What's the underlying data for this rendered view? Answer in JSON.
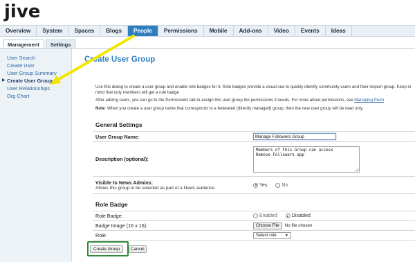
{
  "brand": {
    "logo_text": "jive"
  },
  "top_nav": {
    "tabs": [
      {
        "label": "Overview"
      },
      {
        "label": "System"
      },
      {
        "label": "Spaces"
      },
      {
        "label": "Blogs"
      },
      {
        "label": "People",
        "active": true
      },
      {
        "label": "Permissions"
      },
      {
        "label": "Mobile"
      },
      {
        "label": "Add-ons"
      },
      {
        "label": "Video"
      },
      {
        "label": "Events"
      },
      {
        "label": "Ideas"
      }
    ]
  },
  "sub_tabs": [
    {
      "label": "Management",
      "active": true
    },
    {
      "label": "Settings"
    }
  ],
  "sidebar": {
    "items": [
      {
        "label": "User Search"
      },
      {
        "label": "Create User"
      },
      {
        "label": "User Group Summary"
      },
      {
        "label": "Create User Group",
        "active": true
      },
      {
        "label": "User Relationships"
      },
      {
        "label": "Org Chart"
      }
    ]
  },
  "main": {
    "title": "Create User Group",
    "intro_p1": "Use this dialog to create a user group and enable role badges for it. Role badges provide a visual cue to quickly identify community users and their respon group. Keep in mind that only members will get a role badge",
    "intro_p2_text": "After adding users, you can go to the Permissions tab to assign this user group the permissions it needs. For more about permissions, see ",
    "intro_p2_link": "Managing Perm",
    "note_label": "Note",
    "note_text": ": When you create a user group name that corresponds to a federated (directly managed) group, then the new user group will be read only."
  },
  "general": {
    "heading": "General Settings",
    "name_label": "User Group Name:",
    "name_value": "Manage Followers Group",
    "desc_label": "Description (optional):",
    "desc_value": "Members of this Group can access\nRemove Followers app",
    "visible_label": "Visible to News Admins:",
    "visible_sub": "Allows this group to be selected as part of a News audience.",
    "yes_label": "Yes",
    "no_label": "No"
  },
  "role_badge": {
    "heading": "Role Badge",
    "badge_label": "Role Badge:",
    "enabled_label": "Enabled",
    "disabled_label": "Disabled",
    "image_label": "Badge Image (16 x 16):",
    "choose_file_label": "Choose File",
    "no_file_text": "No file chosen",
    "role_label": "Role:",
    "role_select_value": "Select role"
  },
  "actions": {
    "create_label": "Create Group",
    "cancel_label": "Cancel"
  },
  "colors": {
    "accent": "#2f7fc0",
    "annotation_arrow": "#f2e600",
    "highlight_box": "#2e8b3a"
  }
}
